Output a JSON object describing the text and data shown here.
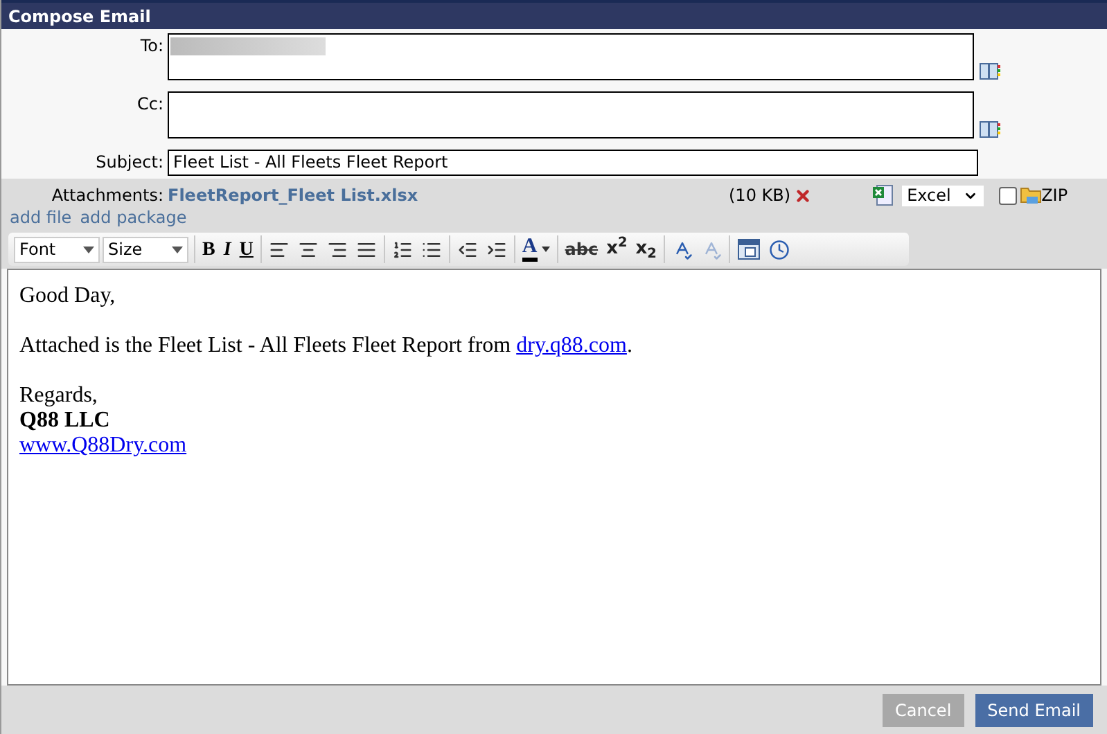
{
  "window": {
    "title": "Compose Email"
  },
  "fields": [
    {
      "label": "To:",
      "kind": "textarea",
      "redacted": true
    },
    {
      "label": "Cc:",
      "kind": "textarea",
      "redacted": false
    },
    {
      "label": "Subject:",
      "kind": "input",
      "value": "Fleet List - All Fleets Fleet Report"
    }
  ],
  "attachments": {
    "label": "Attachments:",
    "file": "FleetReport_Fleet List.xlsx",
    "size": "(10 KB)",
    "format": "Excel",
    "zip": {
      "label": "ZIP",
      "checked": false
    },
    "links": [
      "add file",
      "add package"
    ]
  },
  "toolbar": {
    "groups": [
      [
        {
          "kind": "select",
          "value": "Font",
          "disabled": false
        },
        {
          "kind": "select",
          "value": "Size",
          "disabled": false
        }
      ],
      [
        {
          "kind": "bold",
          "label": "B",
          "disabled": false
        },
        {
          "kind": "italic",
          "label": "I",
          "disabled": false
        },
        {
          "kind": "underline",
          "label": "U",
          "disabled": false
        }
      ],
      [
        {
          "kind": "align-left",
          "disabled": false
        },
        {
          "kind": "align-center",
          "disabled": false
        },
        {
          "kind": "align-right",
          "disabled": false
        },
        {
          "kind": "align-justify",
          "disabled": false
        }
      ],
      [
        {
          "kind": "ordered-list",
          "disabled": false
        },
        {
          "kind": "bullet-list",
          "disabled": false
        }
      ],
      [
        {
          "kind": "outdent",
          "disabled": false
        },
        {
          "kind": "indent",
          "disabled": false
        }
      ],
      [
        {
          "kind": "font-color",
          "label": "A",
          "disabled": false
        }
      ],
      [
        {
          "kind": "strike",
          "label": "abc",
          "disabled": false
        },
        {
          "kind": "rich",
          "label": "x$^{2}$",
          "disabled": false
        },
        {
          "kind": "rich",
          "label": "x$_{2}$",
          "disabled": false
        }
      ],
      [
        {
          "kind": "spellcheck",
          "disabled": false
        },
        {
          "kind": "spellcheck",
          "disabled": true
        }
      ],
      [
        {
          "kind": "calendar",
          "disabled": false
        },
        {
          "kind": "clock",
          "disabled": false
        }
      ]
    ]
  },
  "body": [
    {
      "kind": "text",
      "text": "Good Day,"
    },
    {
      "kind": "blank"
    },
    {
      "kind": "link-sentence",
      "text": "Attached is the Fleet List - All Fleets Fleet Report from ",
      "link": "dry.q88.com",
      "after": "."
    },
    {
      "kind": "blank"
    },
    {
      "kind": "text",
      "text": "Regards,"
    },
    {
      "kind": "bold",
      "text": "Q88 LLC"
    },
    {
      "kind": "link",
      "text": "www.Q88Dry.com"
    }
  ],
  "buttons": [
    {
      "label": "Cancel",
      "disabled": true
    },
    {
      "label": "Send Email",
      "disabled": false
    }
  ]
}
